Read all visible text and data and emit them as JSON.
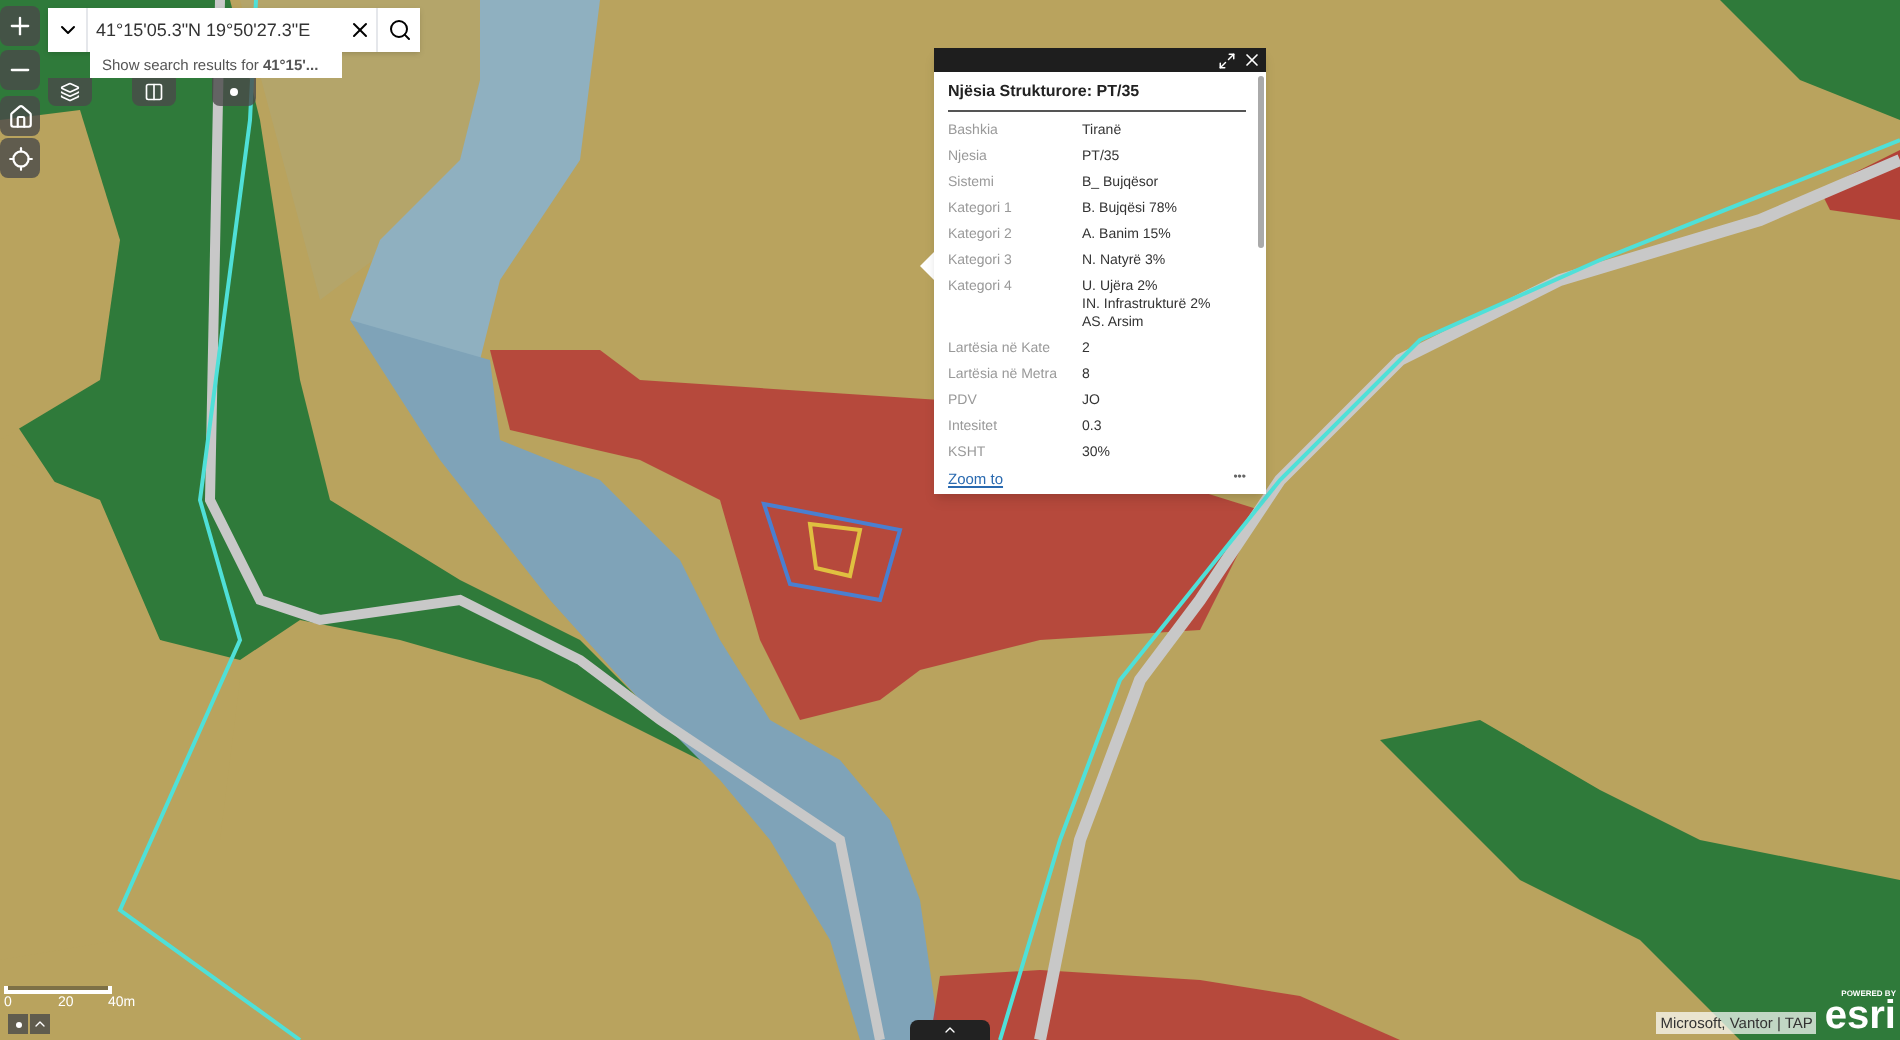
{
  "search": {
    "value": "41°15'05.3\"N 19°50'27.3\"E",
    "suggestion": "Show search results for **41°15'...**"
  },
  "popup": {
    "title": "Njësia Strukturore: PT/35",
    "fields": [
      {
        "label": "Bashkia",
        "lines": [
          "Tiranë"
        ]
      },
      {
        "label": "Njesia",
        "lines": [
          "PT/35"
        ]
      },
      {
        "label": "Sistemi",
        "lines": [
          "B_ Bujqësor"
        ]
      },
      {
        "label": "Kategori 1",
        "lines": [
          "B. Bujqësi 78%"
        ]
      },
      {
        "label": "Kategori 2",
        "lines": [
          "A. Banim 15%"
        ]
      },
      {
        "label": "Kategori 3",
        "lines": [
          "N. Natyrë 3%"
        ]
      },
      {
        "label": "Kategori 4",
        "lines": [
          "U. Ujëra 2%",
          "IN. Infrastrukturë 2%",
          "AS. Arsim"
        ]
      },
      {
        "label": "Lartësia në Kate",
        "lines": [
          "2"
        ]
      },
      {
        "label": "Lartësia në Metra",
        "lines": [
          "8"
        ]
      },
      {
        "label": "PDV",
        "lines": [
          "JO"
        ]
      },
      {
        "label": "Intesitet",
        "lines": [
          "0.3"
        ]
      },
      {
        "label": "KSHT",
        "lines": [
          "30%"
        ]
      }
    ],
    "zoom_link": "Zoom to",
    "more": "•••"
  },
  "scale": {
    "labels": [
      "0",
      "20",
      "40m"
    ]
  },
  "attribution": "Microsoft, Vantor | TAP",
  "logo": {
    "tagline": "POWERED BY",
    "name": "esri"
  }
}
